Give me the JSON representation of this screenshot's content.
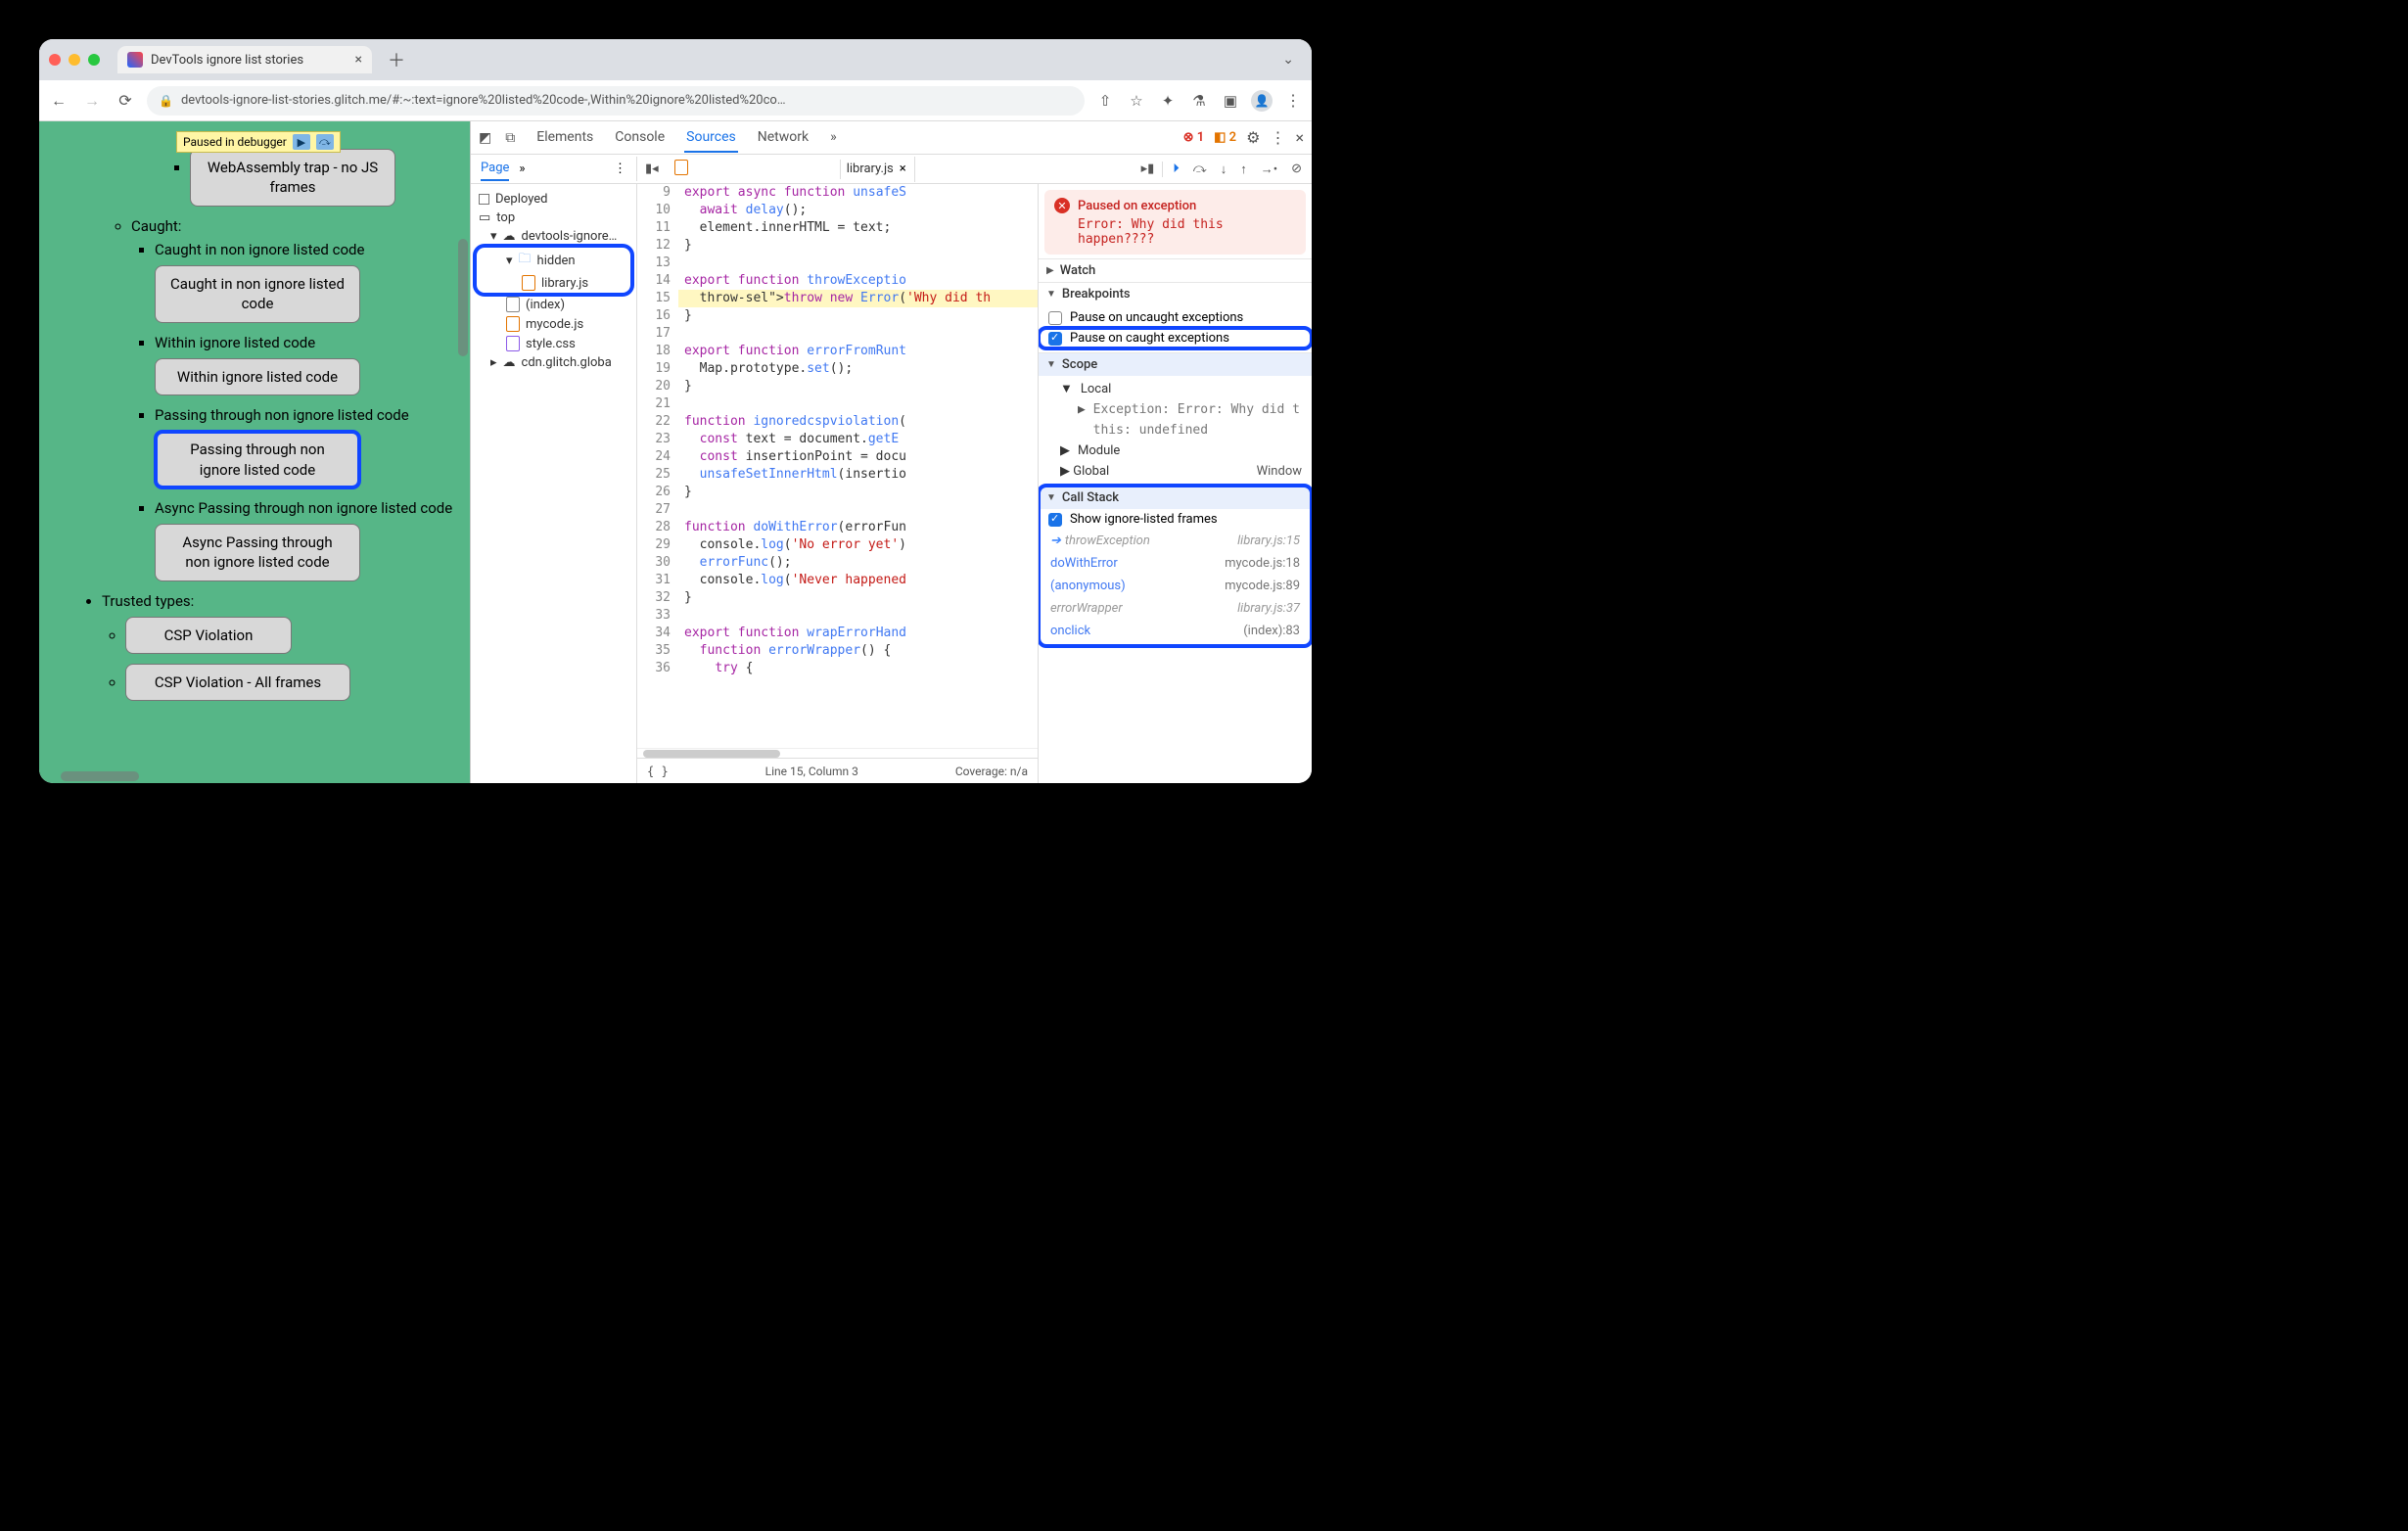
{
  "window": {
    "tab_title": "DevTools ignore list stories",
    "url_display": "devtools-ignore-list-stories.glitch.me/#:~:text=ignore%20listed%20code-,Within%20ignore%20listed%20co…"
  },
  "paused_badge": "Paused in debugger",
  "page": {
    "wasm_btn": "WebAssembly trap - no JS frames",
    "caught_header": "Caught:",
    "li1_text": "Caught in non ignore listed code",
    "li1_btn": "Caught in non ignore listed code",
    "li2_text": "Within ignore listed code",
    "li2_btn": "Within ignore listed code",
    "li3_text": "Passing through non ignore listed code",
    "li3_btn": "Passing through non ignore listed code",
    "li4_text": "Async Passing through non ignore listed code",
    "li4_btn": "Async Passing through non ignore listed code",
    "trusted_header": "Trusted types:",
    "csp1_btn": "CSP Violation",
    "csp2_btn": "CSP Violation - All frames"
  },
  "devtools": {
    "tabs": {
      "elements": "Elements",
      "console": "Console",
      "sources": "Sources",
      "network": "Network"
    },
    "errors": "1",
    "warnings": "2",
    "page_label": "Page",
    "open_file": "library.js",
    "navigator": {
      "deployed": "Deployed",
      "top": "top",
      "origin": "devtools-ignore…",
      "hidden": "hidden",
      "lib": "library.js",
      "index": "(index)",
      "mycode": "mycode.js",
      "style": "style.css",
      "cdn": "cdn.glitch.globa"
    },
    "code": [
      {
        "n": 9,
        "t": "export async function unsafeS"
      },
      {
        "n": 10,
        "t": "  await delay();"
      },
      {
        "n": 11,
        "t": "  element.innerHTML = text;"
      },
      {
        "n": 12,
        "t": "}"
      },
      {
        "n": 13,
        "t": ""
      },
      {
        "n": 14,
        "t": "export function throwExceptio"
      },
      {
        "n": 15,
        "t": "  throw new Error('Why did th",
        "hl": true
      },
      {
        "n": 16,
        "t": "}"
      },
      {
        "n": 17,
        "t": ""
      },
      {
        "n": 18,
        "t": "export function errorFromRunt"
      },
      {
        "n": 19,
        "t": "  Map.prototype.set();"
      },
      {
        "n": 20,
        "t": "}"
      },
      {
        "n": 21,
        "t": ""
      },
      {
        "n": 22,
        "t": "function ignoredcspviolation("
      },
      {
        "n": 23,
        "t": "  const text = document.getE"
      },
      {
        "n": 24,
        "t": "  const insertionPoint = docu"
      },
      {
        "n": 25,
        "t": "  unsafeSetInnerHtml(insertio"
      },
      {
        "n": 26,
        "t": "}"
      },
      {
        "n": 27,
        "t": ""
      },
      {
        "n": 28,
        "t": "function doWithError(errorFun"
      },
      {
        "n": 29,
        "t": "  console.log('No error yet')"
      },
      {
        "n": 30,
        "t": "  errorFunc();"
      },
      {
        "n": 31,
        "t": "  console.log('Never happened"
      },
      {
        "n": 32,
        "t": "}"
      },
      {
        "n": 33,
        "t": ""
      },
      {
        "n": 34,
        "t": "export function wrapErrorHand"
      },
      {
        "n": 35,
        "t": "  function errorWrapper() {"
      },
      {
        "n": 36,
        "t": "    try {"
      }
    ],
    "footer_pos": "Line 15, Column 3",
    "footer_cov": "Coverage: n/a",
    "pause": {
      "title": "Paused on exception",
      "msg": "Error: Why did this happen????"
    },
    "sections": {
      "watch": "Watch",
      "breakpoints": "Breakpoints",
      "pause_uncaught": "Pause on uncaught exceptions",
      "pause_caught": "Pause on caught exceptions",
      "scope": "Scope",
      "local": "Local",
      "exception_k": "Exception",
      "exception_v": ": Error: Why did t",
      "this_k": "this",
      "this_v": ": undefined",
      "module": "Module",
      "global": "Global",
      "global_v": "Window",
      "callstack": "Call Stack",
      "show_ignore": "Show ignore-listed frames"
    },
    "callstack": [
      {
        "fn": "throwException",
        "loc": "library.js:15",
        "dim": true,
        "cur": true
      },
      {
        "fn": "doWithError",
        "loc": "mycode.js:18"
      },
      {
        "fn": "(anonymous)",
        "loc": "mycode.js:89"
      },
      {
        "fn": "errorWrapper",
        "loc": "library.js:37",
        "dim": true
      },
      {
        "fn": "onclick",
        "loc": "(index):83"
      }
    ]
  }
}
